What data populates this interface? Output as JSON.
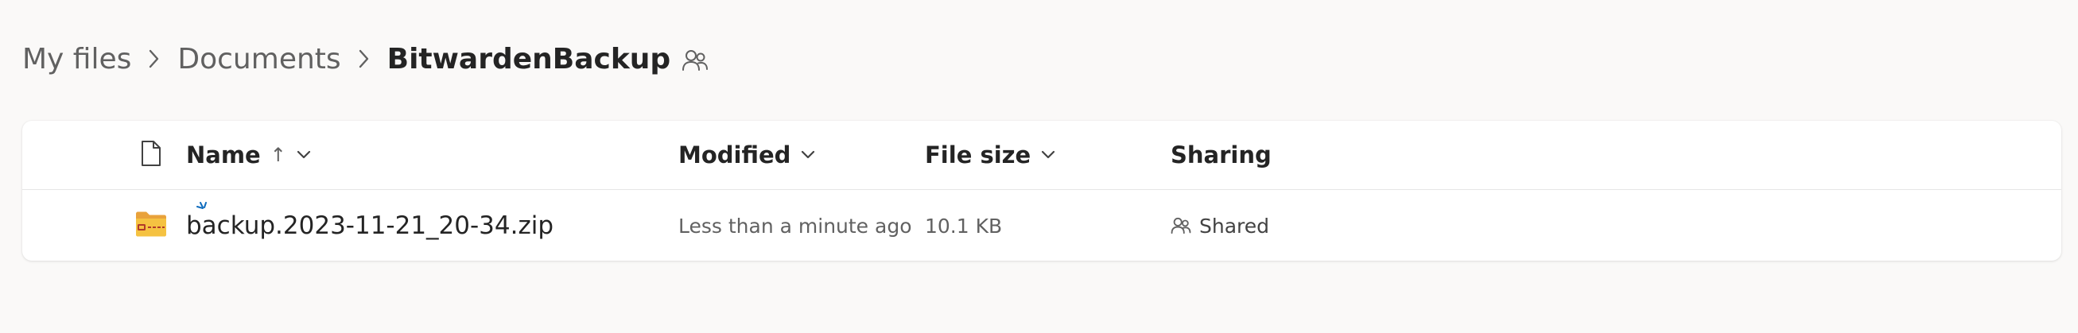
{
  "breadcrumb": {
    "items": [
      "My files",
      "Documents",
      "BitwardenBackup"
    ],
    "folder_status_icon": "shared-people-icon"
  },
  "table": {
    "columns": {
      "type_icon": "file-type-icon",
      "name": "Name",
      "name_sort": "↑",
      "modified": "Modified",
      "file_size": "File size",
      "sharing": "Sharing"
    },
    "rows": [
      {
        "icon": "zip-folder-icon",
        "new_indicator": "new-file-sparkle-icon",
        "name": "backup.2023-11-21_20-34.zip",
        "modified": "Less than a minute ago",
        "file_size": "10.1 KB",
        "sharing": "Shared"
      }
    ]
  },
  "colors": {
    "background": "#faf9f8",
    "card": "#ffffff",
    "text_primary": "#242424",
    "text_secondary": "#616161",
    "zip_folder": "#f5c242",
    "new_indicator": "#0f6cbd"
  }
}
